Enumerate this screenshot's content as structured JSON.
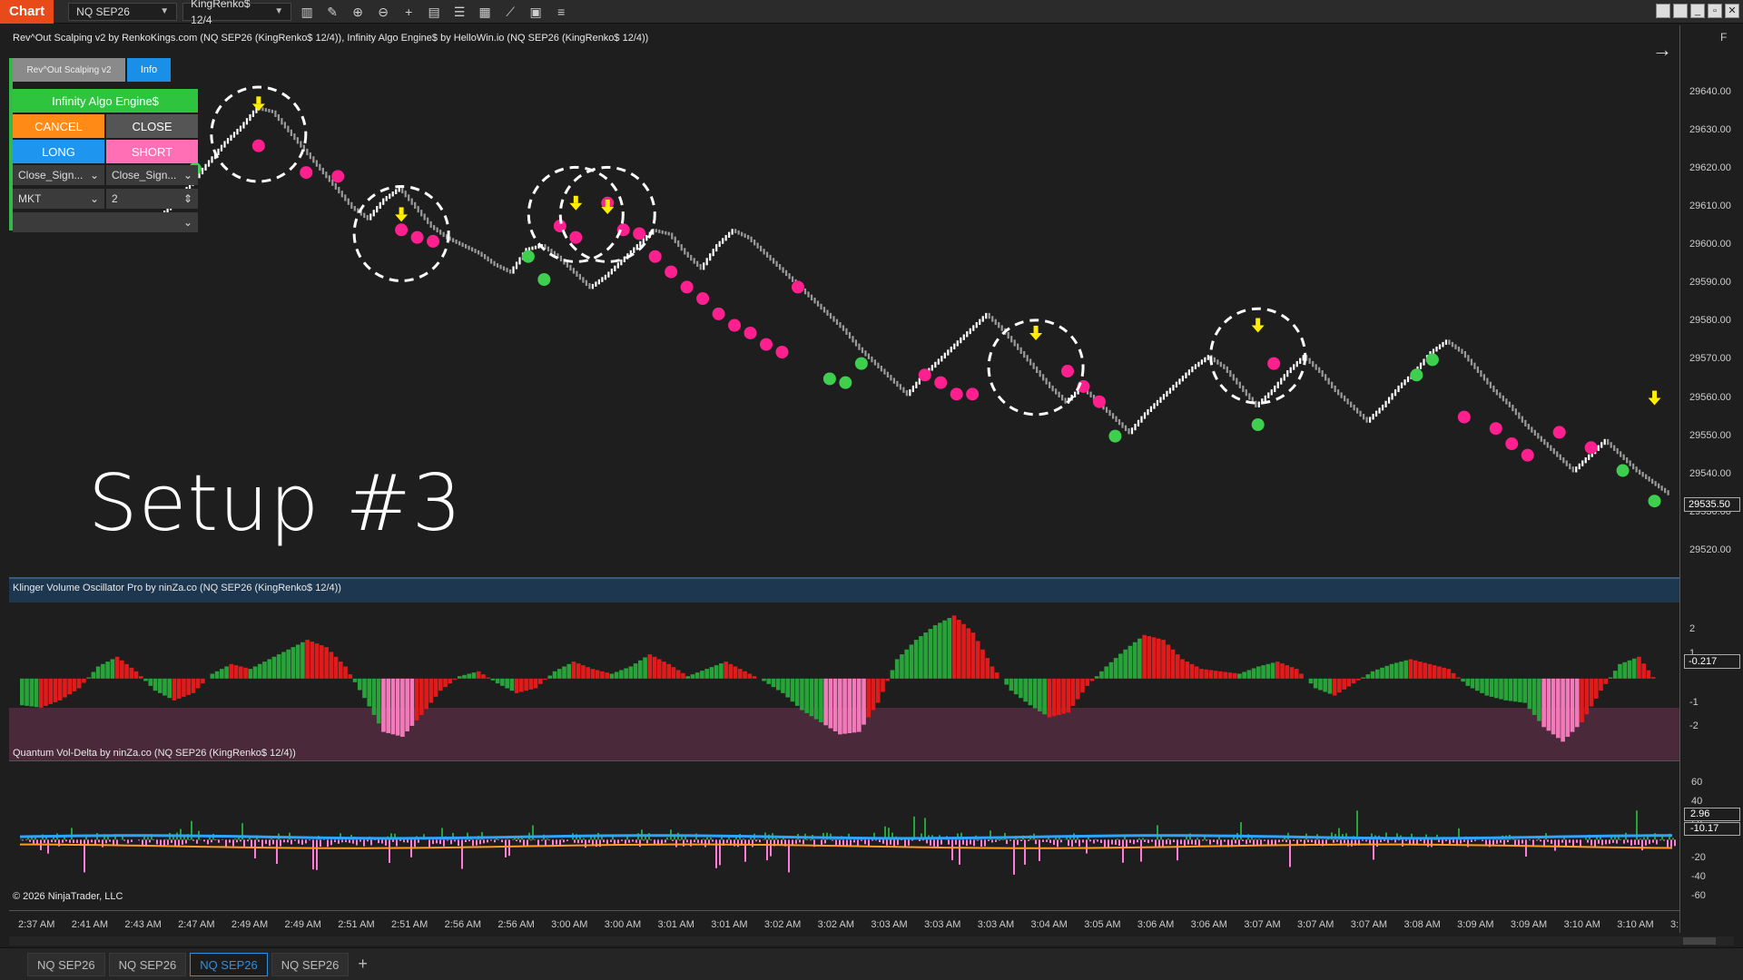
{
  "toolbar": {
    "chart_tag": "Chart",
    "instrument": "NQ SEP26",
    "bar_type": "KingRenko$ 12/4",
    "icons": [
      "bar-type-icon",
      "draw-icon",
      "zoom-in-icon",
      "zoom-out-icon",
      "crosshair-icon",
      "properties-icon",
      "strategies-icon",
      "indicators-icon",
      "templates-icon",
      "data-box-icon",
      "list-icon"
    ]
  },
  "main_panel": {
    "title": "Rev^Out Scalping v2 by RenkoKings.com (NQ SEP26 (KingRenko$ 12/4)), Infinity Algo Engine$ by HelloWin.io (NQ SEP26 (KingRenko$ 12/4))",
    "setup_label": "Setup #3",
    "f_label": "F",
    "price_ticks": [
      "29640.00",
      "29630.00",
      "29620.00",
      "29610.00",
      "29600.00",
      "29590.00",
      "29580.00",
      "29570.00",
      "29560.00",
      "29550.00",
      "29540.00",
      "29530.00",
      "29520.00"
    ],
    "current_price": "29535.50"
  },
  "order_panel": {
    "rev_out_btn": "Rev^Out Scalping v2",
    "info_btn": "Info",
    "engine_label": "Infinity Algo Engine$",
    "cancel_btn": "CANCEL",
    "close_btn": "CLOSE",
    "long_btn": "LONG",
    "short_btn": "SHORT",
    "signal_left": "Close_Sign...",
    "signal_right": "Close_Sign...",
    "order_type": "MKT",
    "quantity": "2"
  },
  "klinger_panel": {
    "title": "Klinger Volume Oscillator Pro by ninZa.co (NQ SEP26 (KingRenko$ 12/4))",
    "ticks": [
      "2",
      "1",
      "-1",
      "-2"
    ],
    "current_value": "-0.217"
  },
  "vol_delta_panel": {
    "title": "Quantum Vol-Delta by ninZa.co (NQ SEP26 (KingRenko$ 12/4))",
    "ticks": [
      "60",
      "40",
      "20",
      "-20",
      "-40",
      "-60"
    ],
    "value_a": "2.96",
    "value_b": "-10.17",
    "copyright": "© 2026 NinjaTrader, LLC"
  },
  "time_axis": [
    "2:37 AM",
    "2:41 AM",
    "2:43 AM",
    "2:47 AM",
    "2:49 AM",
    "2:49 AM",
    "2:51 AM",
    "2:51 AM",
    "2:56 AM",
    "2:56 AM",
    "3:00 AM",
    "3:00 AM",
    "3:01 AM",
    "3:01 AM",
    "3:02 AM",
    "3:02 AM",
    "3:03 AM",
    "3:03 AM",
    "3:03 AM",
    "3:04 AM",
    "3:05 AM",
    "3:06 AM",
    "3:06 AM",
    "3:07 AM",
    "3:07 AM",
    "3:07 AM",
    "3:08 AM",
    "3:09 AM",
    "3:09 AM",
    "3:10 AM",
    "3:10 AM",
    "3:10 AM"
  ],
  "tabs": [
    "NQ SEP26",
    "NQ SEP26",
    "NQ SEP26",
    "NQ SEP26"
  ],
  "active_tab": 2,
  "colors": {
    "background": "#1e1e1e",
    "up_bar": "#ffffff",
    "down_bar": "#9a9a9a",
    "sell_dot": "#ff1f8f",
    "buy_dot": "#3ecf4f",
    "arrow": "#ffee00",
    "klinger_green": "#27a33a",
    "klinger_red": "#e01b1b",
    "klinger_pink": "#f27aba",
    "klinger_band": "#4a2a3a",
    "delta_blue": "#2fa4ff",
    "delta_orange": "#ff9a22",
    "delta_pink": "#ff7ad9"
  },
  "chart_data": {
    "type": "renko_with_signals",
    "price_path": [
      [
        0,
        29608
      ],
      [
        1,
        29612
      ],
      [
        2,
        29617
      ],
      [
        3,
        29622
      ],
      [
        4,
        29627
      ],
      [
        5,
        29631
      ],
      [
        6,
        29636
      ],
      [
        7,
        29635
      ],
      [
        8,
        29630
      ],
      [
        9,
        29625
      ],
      [
        10,
        29620
      ],
      [
        11,
        29615
      ],
      [
        12,
        29610
      ],
      [
        13,
        29607
      ],
      [
        14,
        29612
      ],
      [
        15,
        29615
      ],
      [
        16,
        29610
      ],
      [
        17,
        29605
      ],
      [
        18,
        29602
      ],
      [
        19,
        29600
      ],
      [
        20,
        29598
      ],
      [
        21,
        29595
      ],
      [
        22,
        29593
      ],
      [
        23,
        29599
      ],
      [
        24,
        29600
      ],
      [
        25,
        29597
      ],
      [
        26,
        29593
      ],
      [
        27,
        29589
      ],
      [
        28,
        29592
      ],
      [
        29,
        29596
      ],
      [
        30,
        29600
      ],
      [
        31,
        29604
      ],
      [
        32,
        29603
      ],
      [
        33,
        29598
      ],
      [
        34,
        29594
      ],
      [
        35,
        29600
      ],
      [
        36,
        29604
      ],
      [
        37,
        29602
      ],
      [
        38,
        29598
      ],
      [
        39,
        29594
      ],
      [
        40,
        29590
      ],
      [
        41,
        29586
      ],
      [
        42,
        29582
      ],
      [
        43,
        29578
      ],
      [
        44,
        29573
      ],
      [
        45,
        29569
      ],
      [
        46,
        29565
      ],
      [
        47,
        29561
      ],
      [
        48,
        29566
      ],
      [
        49,
        29570
      ],
      [
        50,
        29574
      ],
      [
        51,
        29578
      ],
      [
        52,
        29582
      ],
      [
        53,
        29578
      ],
      [
        54,
        29573
      ],
      [
        55,
        29568
      ],
      [
        56,
        29563
      ],
      [
        57,
        29559
      ],
      [
        58,
        29563
      ],
      [
        59,
        29559
      ],
      [
        60,
        29555
      ],
      [
        61,
        29551
      ],
      [
        62,
        29556
      ],
      [
        63,
        29560
      ],
      [
        64,
        29564
      ],
      [
        65,
        29568
      ],
      [
        66,
        29571
      ],
      [
        67,
        29568
      ],
      [
        68,
        29563
      ],
      [
        69,
        29558
      ],
      [
        70,
        29562
      ],
      [
        71,
        29567
      ],
      [
        72,
        29571
      ],
      [
        73,
        29567
      ],
      [
        74,
        29562
      ],
      [
        75,
        29558
      ],
      [
        76,
        29554
      ],
      [
        77,
        29558
      ],
      [
        78,
        29563
      ],
      [
        79,
        29567
      ],
      [
        80,
        29572
      ],
      [
        81,
        29575
      ],
      [
        82,
        29572
      ],
      [
        83,
        29567
      ],
      [
        84,
        29562
      ],
      [
        85,
        29558
      ],
      [
        86,
        29553
      ],
      [
        87,
        29549
      ],
      [
        88,
        29545
      ],
      [
        89,
        29541
      ],
      [
        90,
        29545
      ],
      [
        91,
        29549
      ],
      [
        92,
        29545
      ],
      [
        93,
        29541
      ],
      [
        94,
        29538
      ],
      [
        95,
        29535
      ]
    ],
    "sell_signals": [
      [
        6,
        29626
      ],
      [
        9,
        29619
      ],
      [
        11,
        29618
      ],
      [
        15,
        29604
      ],
      [
        16,
        29602
      ],
      [
        17,
        29601
      ],
      [
        25,
        29605
      ],
      [
        26,
        29602
      ],
      [
        28,
        29611
      ],
      [
        29,
        29604
      ],
      [
        30,
        29603
      ],
      [
        31,
        29597
      ],
      [
        32,
        29593
      ],
      [
        33,
        29589
      ],
      [
        34,
        29586
      ],
      [
        35,
        29582
      ],
      [
        36,
        29579
      ],
      [
        37,
        29577
      ],
      [
        38,
        29574
      ],
      [
        39,
        29572
      ],
      [
        40,
        29589
      ],
      [
        48,
        29566
      ],
      [
        49,
        29564
      ],
      [
        50,
        29561
      ],
      [
        51,
        29561
      ],
      [
        57,
        29567
      ],
      [
        58,
        29563
      ],
      [
        59,
        29559
      ],
      [
        70,
        29569
      ],
      [
        82,
        29555
      ],
      [
        84,
        29552
      ],
      [
        85,
        29548
      ],
      [
        86,
        29545
      ],
      [
        88,
        29551
      ],
      [
        90,
        29547
      ]
    ],
    "buy_signals": [
      [
        1,
        29618
      ],
      [
        2,
        29620
      ],
      [
        23,
        29597
      ],
      [
        24,
        29591
      ],
      [
        42,
        29565
      ],
      [
        43,
        29564
      ],
      [
        44,
        29569
      ],
      [
        60,
        29550
      ],
      [
        69,
        29553
      ],
      [
        79,
        29566
      ],
      [
        80,
        29570
      ],
      [
        92,
        29541
      ],
      [
        94,
        29533
      ]
    ],
    "arrows": [
      [
        6,
        29637
      ],
      [
        15,
        29608
      ],
      [
        26,
        29611
      ],
      [
        28,
        29610
      ],
      [
        55,
        29577
      ],
      [
        69,
        29579
      ],
      [
        94,
        29560
      ]
    ],
    "circled_setups": [
      [
        6,
        29629
      ],
      [
        15,
        29603
      ],
      [
        26,
        29608
      ],
      [
        28,
        29608
      ],
      [
        55,
        29568
      ],
      [
        69,
        29571
      ]
    ],
    "klinger": [
      -1.1,
      -1.2,
      -0.9,
      -0.4,
      0.5,
      0.9,
      0.3,
      -0.5,
      -0.9,
      -0.6,
      0.2,
      0.6,
      0.4,
      0.8,
      1.2,
      1.6,
      1.3,
      0.5,
      -0.8,
      -2.2,
      -2.4,
      -1.5,
      -0.5,
      0.1,
      0.3,
      -0.2,
      -0.6,
      -0.4,
      0.3,
      0.7,
      0.4,
      0.2,
      0.5,
      1.0,
      0.6,
      0.1,
      0.4,
      0.7,
      0.3,
      -0.1,
      -0.6,
      -1.3,
      -1.8,
      -2.3,
      -2.2,
      -1.0,
      0.8,
      1.6,
      2.2,
      2.6,
      1.9,
      0.5,
      -0.5,
      -1.1,
      -1.6,
      -1.4,
      -0.3,
      0.5,
      1.2,
      1.8,
      1.6,
      0.8,
      0.4,
      0.3,
      0.2,
      0.5,
      0.7,
      0.4,
      -0.4,
      -0.7,
      -0.2,
      0.3,
      0.6,
      0.8,
      0.6,
      0.4,
      -0.3,
      -0.7,
      -0.9,
      -1.0,
      -2.0,
      -2.6,
      -1.8,
      -0.5,
      0.6,
      0.9,
      -0.217
    ],
    "price_ylim": [
      29515,
      29648
    ],
    "klinger_ylim": [
      -3,
      2.8
    ],
    "delta_ylim": [
      -70,
      65
    ]
  }
}
